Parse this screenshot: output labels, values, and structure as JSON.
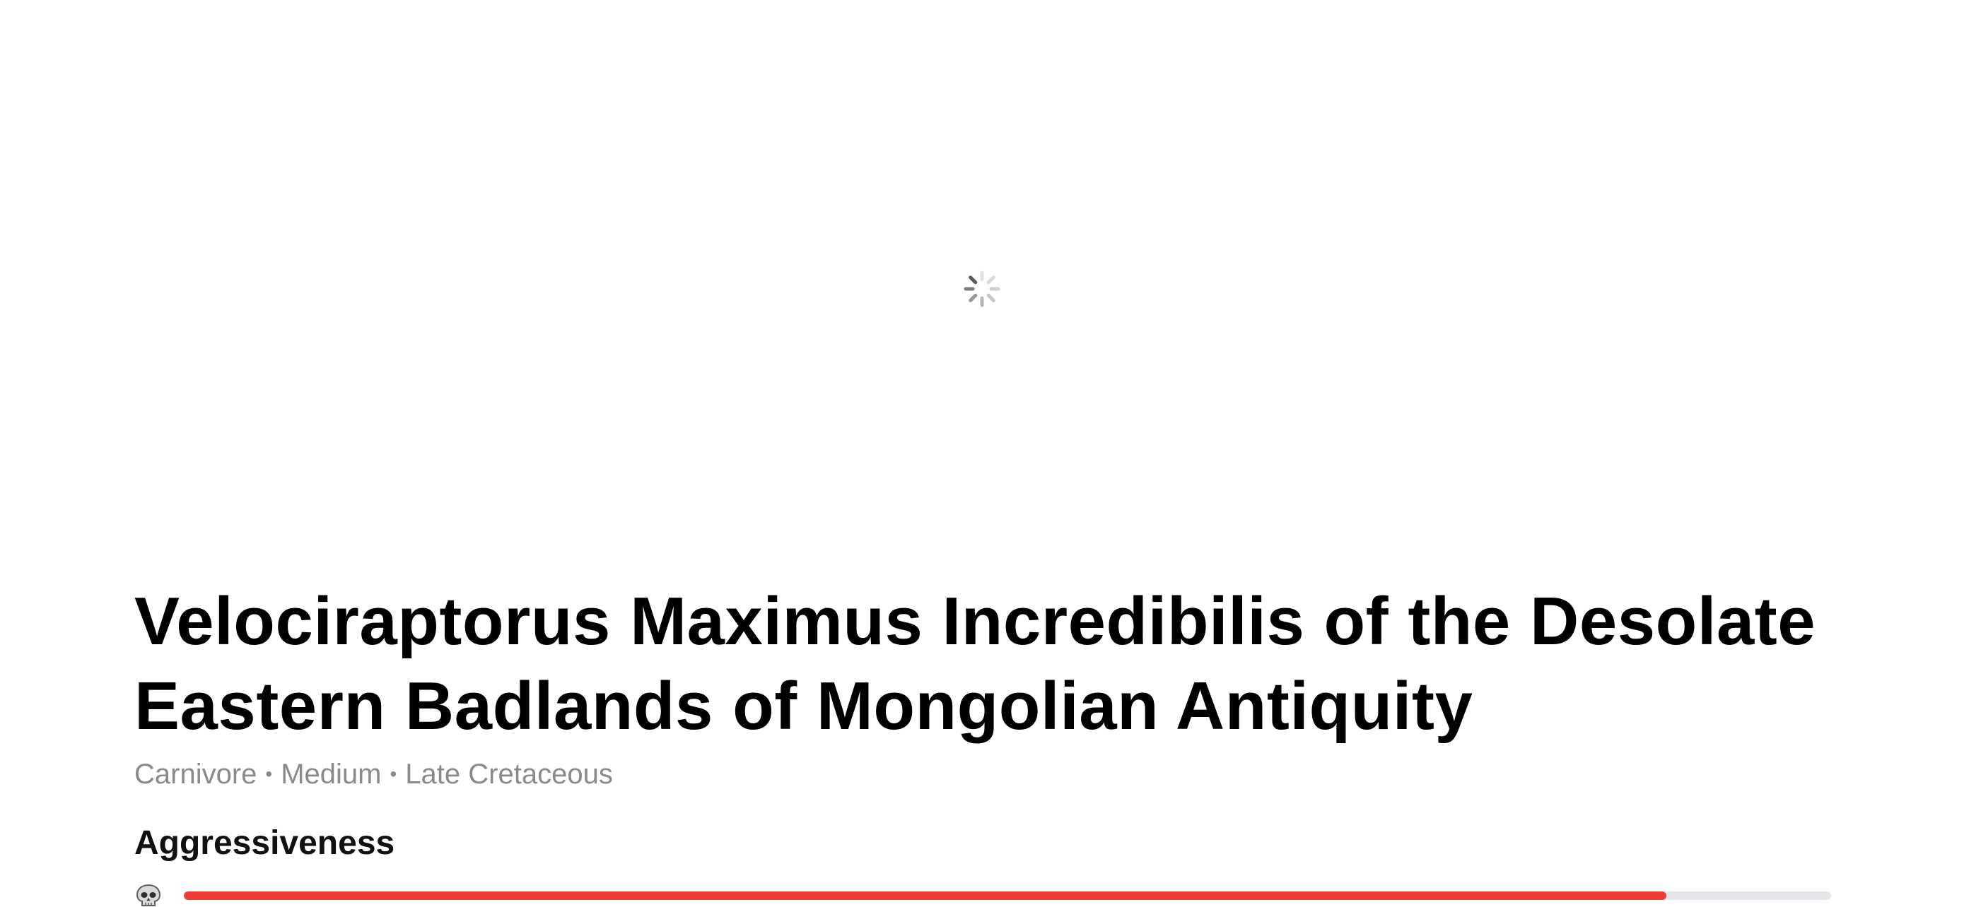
{
  "hero": {
    "status": "loading",
    "icon": "spinner-icon"
  },
  "dinosaur": {
    "title": "Velociraptorus Maximus Incredibilis of the Desolate Eastern Badlands of Mongolian Antiquity",
    "meta": {
      "diet": "Carnivore",
      "size": "Medium",
      "period": "Late Cretaceous",
      "separator": "•"
    }
  },
  "aggressiveness": {
    "label": "Aggressiveness",
    "icon": "skull-icon",
    "value_fraction": 0.9,
    "fill_color": "#ef3b34",
    "track_color": "#e5e5ea"
  }
}
